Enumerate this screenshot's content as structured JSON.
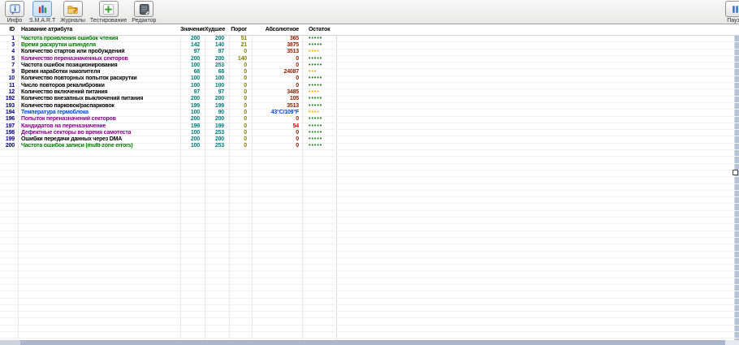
{
  "palette": {
    "navy": "#000082",
    "black": "#000000",
    "green": "#007a00",
    "purple": "#8b008b",
    "blue": "#0046d5",
    "teal": "#007d7d",
    "olive": "#7d7d00",
    "maroon": "#8b1c00",
    "red": "#f00000",
    "dot_green": "#1d7a1d",
    "dot_orange": "#f5a800",
    "selected_button_border": "#6ba0d8",
    "scrollbar": "#b5c1d5"
  },
  "toolbar": {
    "buttons": [
      {
        "label": "Инфо",
        "icon": "info"
      },
      {
        "label": "S.M.A.R.T",
        "icon": "smart-bars",
        "selected": true
      },
      {
        "label": "Журналы",
        "icon": "journals-folder"
      },
      {
        "label": "Тестирование",
        "icon": "test-plus"
      },
      {
        "label": "Редактор",
        "icon": "editor-pad"
      }
    ],
    "pause_label": "Пауза"
  },
  "table": {
    "columns": [
      "ID",
      "Название атрибута",
      "Значение",
      "Худшее",
      "Порог",
      "Абсолютное",
      "Остаток"
    ],
    "empty_rows": 28,
    "rows": [
      {
        "id": "1",
        "name": "Частота проявления ошибок чтения",
        "name_color": "green",
        "value": "200",
        "worst": "200",
        "threshold": "51",
        "absolute": "365",
        "absolute_color": "maroon",
        "dots": 5,
        "dots_color": "dot_green"
      },
      {
        "id": "3",
        "name": "Время раскрутки шпинделя",
        "name_color": "green",
        "value": "142",
        "worst": "140",
        "threshold": "21",
        "absolute": "3875",
        "absolute_color": "maroon",
        "dots": 5,
        "dots_color": "dot_green"
      },
      {
        "id": "4",
        "name": "Количество стартов или пробуждений",
        "name_color": "black",
        "value": "97",
        "worst": "97",
        "threshold": "0",
        "absolute": "3513",
        "absolute_color": "maroon",
        "dots": 4,
        "dots_color": "dot_orange"
      },
      {
        "id": "5",
        "name": "Количество переназначенных секторов",
        "name_color": "purple",
        "value": "200",
        "worst": "200",
        "threshold": "140",
        "absolute": "0",
        "absolute_color": "maroon",
        "dots": 5,
        "dots_color": "dot_green"
      },
      {
        "id": "7",
        "name": "Частота ошибок позиционирования",
        "name_color": "black",
        "value": "100",
        "worst": "253",
        "threshold": "0",
        "absolute": "0",
        "absolute_color": "maroon",
        "dots": 5,
        "dots_color": "dot_green"
      },
      {
        "id": "9",
        "name": "Время наработки накопителя",
        "name_color": "black",
        "value": "68",
        "worst": "68",
        "threshold": "0",
        "absolute": "24087",
        "absolute_color": "maroon",
        "dots": 3,
        "dots_color": "dot_orange"
      },
      {
        "id": "10",
        "name": "Количество повторных попыток раскрутки",
        "name_color": "black",
        "value": "100",
        "worst": "100",
        "threshold": "0",
        "absolute": "0",
        "absolute_color": "maroon",
        "dots": 5,
        "dots_color": "dot_green"
      },
      {
        "id": "11",
        "name": "Число повторов рекалибровки",
        "name_color": "black",
        "value": "100",
        "worst": "100",
        "threshold": "0",
        "absolute": "0",
        "absolute_color": "maroon",
        "dots": 5,
        "dots_color": "dot_green"
      },
      {
        "id": "12",
        "name": "Количество включений питания",
        "name_color": "black",
        "value": "97",
        "worst": "97",
        "threshold": "0",
        "absolute": "3485",
        "absolute_color": "maroon",
        "dots": 4,
        "dots_color": "dot_orange"
      },
      {
        "id": "192",
        "name": "Количество внезапных выключений питания",
        "name_color": "black",
        "value": "200",
        "worst": "200",
        "threshold": "0",
        "absolute": "105",
        "absolute_color": "maroon",
        "dots": 5,
        "dots_color": "dot_green"
      },
      {
        "id": "193",
        "name": "Количество парковок/распарковок",
        "name_color": "black",
        "value": "199",
        "worst": "199",
        "threshold": "0",
        "absolute": "3513",
        "absolute_color": "maroon",
        "dots": 5,
        "dots_color": "dot_green"
      },
      {
        "id": "194",
        "name": "Температура гермоблока",
        "name_color": "blue",
        "value": "100",
        "worst": "90",
        "threshold": "0",
        "absolute": "43°C/109°F",
        "absolute_color": "blue",
        "dots": 4,
        "dots_color": "dot_orange"
      },
      {
        "id": "196",
        "name": "Попыток переназначений секторов",
        "name_color": "purple",
        "value": "200",
        "worst": "200",
        "threshold": "0",
        "absolute": "0",
        "absolute_color": "maroon",
        "dots": 5,
        "dots_color": "dot_green"
      },
      {
        "id": "197",
        "name": "Кандидатов на переназначение",
        "name_color": "purple",
        "value": "199",
        "worst": "199",
        "threshold": "0",
        "absolute": "54",
        "absolute_color": "red",
        "dots": 5,
        "dots_color": "dot_green"
      },
      {
        "id": "198",
        "name": "Дефектные секторы во время самотеста",
        "name_color": "purple",
        "value": "100",
        "worst": "253",
        "threshold": "0",
        "absolute": "0",
        "absolute_color": "maroon",
        "dots": 5,
        "dots_color": "dot_green"
      },
      {
        "id": "199",
        "name": "Ошибки передачи данных через DMA",
        "name_color": "black",
        "value": "200",
        "worst": "200",
        "threshold": "0",
        "absolute": "0",
        "absolute_color": "maroon",
        "dots": 5,
        "dots_color": "dot_green"
      },
      {
        "id": "200",
        "name": "Частота ошибок записи (multi-zone errors)",
        "name_color": "green",
        "value": "100",
        "worst": "253",
        "threshold": "0",
        "absolute": "0",
        "absolute_color": "maroon",
        "dots": 5,
        "dots_color": "dot_green"
      }
    ]
  }
}
